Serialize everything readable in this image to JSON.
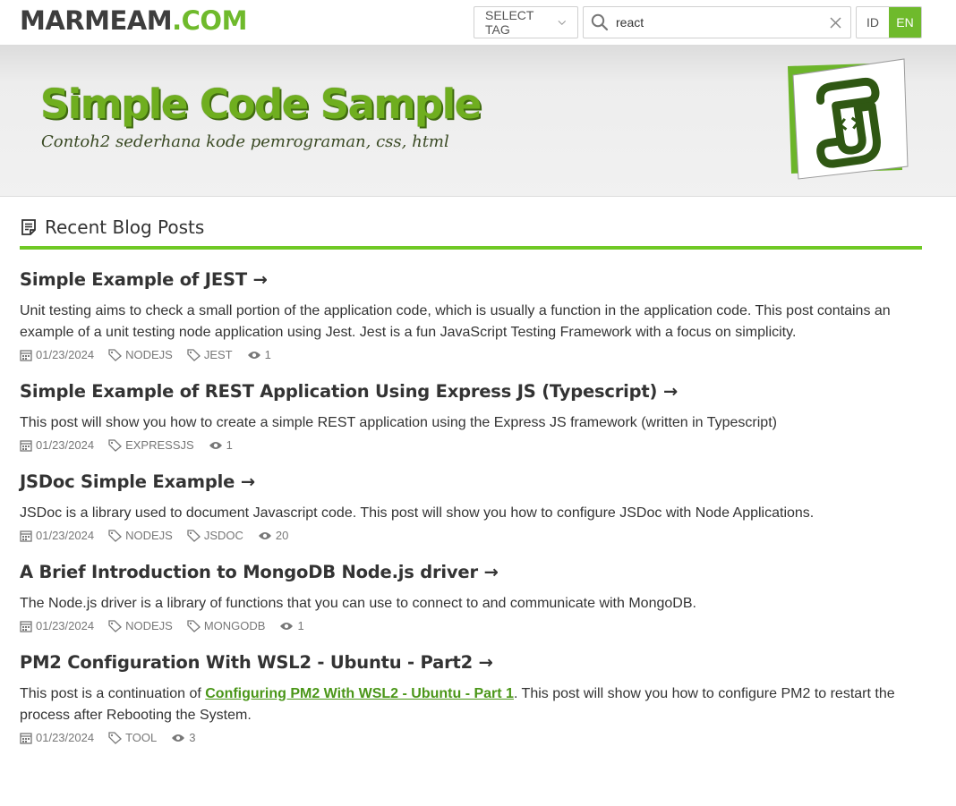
{
  "header": {
    "logo_main": "MARMEAM",
    "logo_dot": ".",
    "logo_tld": "COM",
    "select_tag_label": "SELECT TAG",
    "search_value": "react",
    "lang_id": "ID",
    "lang_en": "EN",
    "accent_color": "#6fba2c"
  },
  "banner": {
    "title": "Simple Code Sample",
    "subtitle": "Contoh2 sederhana kode pemrograman, css, html"
  },
  "section": {
    "title": "Recent Blog Posts"
  },
  "posts": [
    {
      "title": "Simple Example of JEST →",
      "desc": "Unit testing aims to check a small portion of the application code, which is usually a function in the application code. This post contains an example of a unit testing node application using Jest. Jest is a fun JavaScript Testing Framework with a focus on simplicity.",
      "date": "01/23/2024",
      "tags": [
        "NODEJS",
        "JEST"
      ],
      "views": "1"
    },
    {
      "title": "Simple Example of REST Application Using Express JS (Typescript) →",
      "desc": "This post will show you how to create a simple REST application using the Express JS framework (written in Typescript)",
      "date": "01/23/2024",
      "tags": [
        "EXPRESSJS"
      ],
      "views": "1"
    },
    {
      "title": "JSDoc Simple Example →",
      "desc": "JSDoc is a library used to document Javascript code. This post will show you how to configure JSDoc with Node Applications.",
      "date": "01/23/2024",
      "tags": [
        "NODEJS",
        "JSDOC"
      ],
      "views": "20"
    },
    {
      "title": "A Brief Introduction to MongoDB Node.js driver →",
      "desc": "The Node.js driver is a library of functions that you can use to connect to and communicate with MongoDB.",
      "date": "01/23/2024",
      "tags": [
        "NODEJS",
        "MONGODB"
      ],
      "views": "1"
    },
    {
      "title": "PM2 Configuration With WSL2 - Ubuntu - Part2 →",
      "desc_before": "This post is a continuation of ",
      "desc_link": "Configuring PM2 With WSL2 - Ubuntu - Part 1",
      "desc_after": ". This post will show you how to configure PM2 to restart the process after Rebooting the System.",
      "date": "01/23/2024",
      "tags": [
        "TOOL"
      ],
      "views": "3"
    }
  ]
}
